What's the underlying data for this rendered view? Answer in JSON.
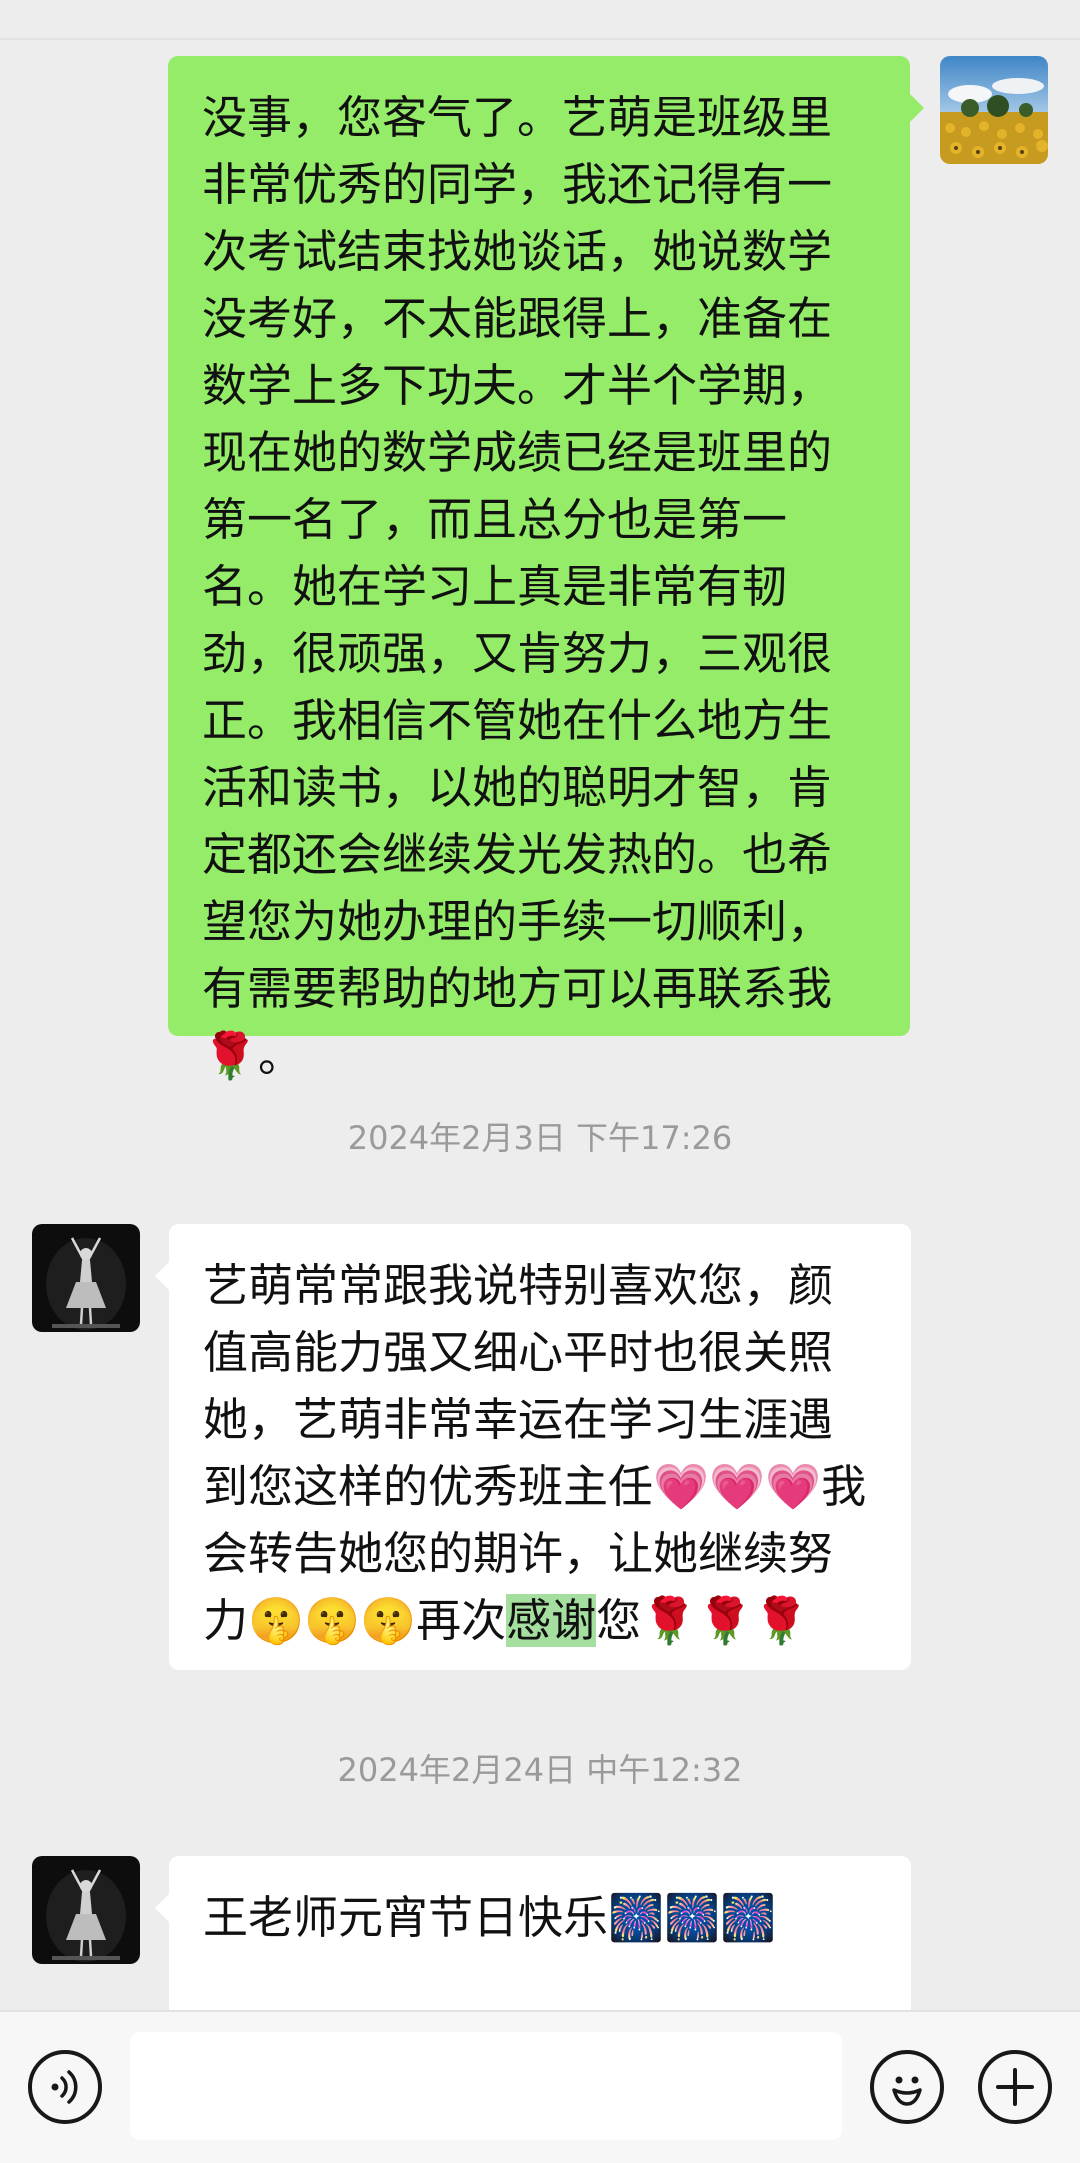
{
  "messages": [
    {
      "sender": "me",
      "text": "没事，您客气了。艺萌是班级里非常优秀的同学，我还记得有一次考试结束找她谈话，她说数学没考好，不太能跟得上，准备在数学上多下功夫。才半个学期，现在她的数学成绩已经是班里的第一名了，而且总分也是第一名。她在学习上真是非常有韧劲，很顽强，又肯努力，三观很正。我相信不管她在什么地方生活和读书，以她的聪明才智，肯定都还会继续发光发热的。也希望您为她办理的手续一切顺利，有需要帮助的地方可以再联系我🌹。"
    },
    {
      "timestamp": "2024年2月3日 下午17:26"
    },
    {
      "sender": "other",
      "text_before": "艺萌常常跟我说特别喜欢您，颜值高能力强又细心平时也很关照她，艺萌非常幸运在学习生涯遇到您这样的优秀班主任💗💗💗我会转告她您的期许，让她继续努力🤫🤫🤫再次",
      "text_highlight": "感谢",
      "text_after": "您🌹🌹🌹"
    },
    {
      "timestamp": "2024年2月24日 中午12:32"
    },
    {
      "sender": "other",
      "text": "王老师元宵节日快乐🎆🎆🎆"
    }
  ],
  "input": {
    "value": "",
    "placeholder": ""
  },
  "icons": {
    "voice": "voice-icon",
    "emoji": "emoji-icon",
    "plus": "plus-icon"
  },
  "colors": {
    "my_bubble": "#95ec69",
    "their_bubble": "#ffffff",
    "background": "#ededed",
    "highlight": "#a5dfa0"
  }
}
